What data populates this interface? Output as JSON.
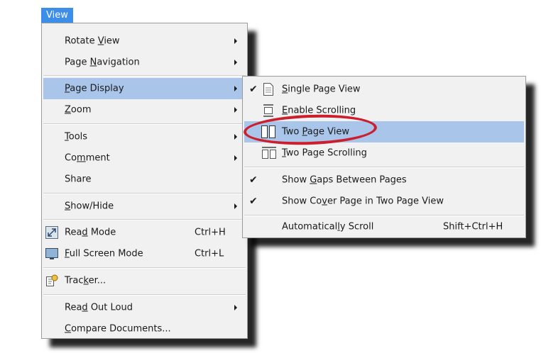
{
  "menubar": {
    "view_label": "View"
  },
  "view_menu": {
    "rotate_view": {
      "pre": "Rotate ",
      "key": "V",
      "post": "iew"
    },
    "page_navigation": {
      "pre": "Page ",
      "key": "N",
      "post": "avigation"
    },
    "page_display": {
      "pre": "",
      "key": "P",
      "post": "age Display"
    },
    "zoom": {
      "pre": "",
      "key": "Z",
      "post": "oom"
    },
    "tools": {
      "pre": "",
      "key": "T",
      "post": "ools"
    },
    "comment": {
      "pre": "Co",
      "key": "m",
      "post": "ment"
    },
    "share": {
      "label": "Share"
    },
    "show_hide": {
      "pre": "",
      "key": "S",
      "post": "how/Hide"
    },
    "read_mode": {
      "pre": "Rea",
      "key": "d",
      "post": " Mode",
      "shortcut": "Ctrl+H"
    },
    "full_screen_mode": {
      "pre": "",
      "key": "F",
      "post": "ull Screen Mode",
      "shortcut": "Ctrl+L"
    },
    "tracker": {
      "pre": "Trac",
      "key": "k",
      "post": "er..."
    },
    "read_out_loud": {
      "pre": "Rea",
      "key": "d",
      "post": " Out Loud"
    },
    "compare_documents": {
      "pre": "",
      "key": "C",
      "post": "ompare Documents..."
    }
  },
  "page_display_menu": {
    "single_page_view": {
      "pre": "",
      "key": "S",
      "post": "ingle Page View",
      "checked": true
    },
    "enable_scrolling": {
      "pre": "",
      "key": "E",
      "post": "nable Scrolling"
    },
    "two_page_view": {
      "pre": "Two ",
      "key": "P",
      "post": "age View"
    },
    "two_page_scrolling": {
      "pre": "",
      "key": "T",
      "post": "wo Page Scrolling"
    },
    "show_gaps": {
      "pre": "Show ",
      "key": "G",
      "post": "aps Between Pages",
      "checked": true
    },
    "show_cover": {
      "pre": "Show Co",
      "key": "v",
      "post": "er Page in Two Page View",
      "checked": true
    },
    "auto_scroll": {
      "pre": "Automatical",
      "key": "l",
      "post": "y Scroll",
      "shortcut": "Shift+Ctrl+H"
    }
  },
  "colors": {
    "menubar_accent": "#3c8ee8",
    "highlight": "#a9c5ea",
    "annotation_ring": "#cc1f2d"
  }
}
